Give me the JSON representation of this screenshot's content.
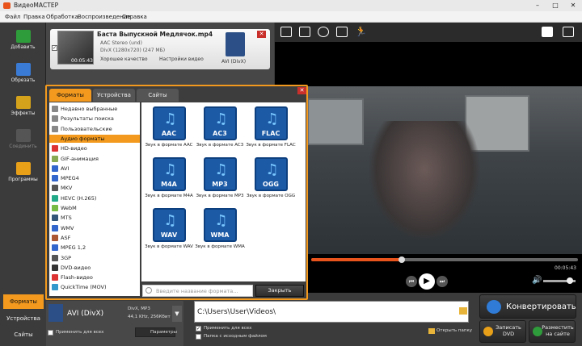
{
  "app": {
    "title": "ВидеоМАСТЕР"
  },
  "menu": [
    "Файл",
    "Правка",
    "Обработка",
    "Воспроизведение",
    "Справка"
  ],
  "sidebar": [
    {
      "label": "Добавить",
      "icon": "add-icon",
      "enabled": true
    },
    {
      "label": "Обрезать",
      "icon": "scissors-icon",
      "enabled": true
    },
    {
      "label": "Эффекты",
      "icon": "effects-icon",
      "enabled": true
    },
    {
      "label": "Соединить",
      "icon": "join-icon",
      "enabled": false
    },
    {
      "label": "Программы",
      "icon": "programs-icon",
      "enabled": true
    }
  ],
  "file": {
    "name": "Баста   Выпускной Медлячок.mp4",
    "audio": "AAC Stereo (und)",
    "video": "DivX (1280x720) (247 МБ)",
    "duration": "00:05:43",
    "quality": "Хорошее качество",
    "settings": "Настройки видео",
    "format": "AVI (DivX)"
  },
  "dialog": {
    "tabs": [
      "Форматы",
      "Устройства",
      "Сайты"
    ],
    "categories": [
      "Недавно выбранные",
      "Результаты поиска",
      "Пользовательские",
      "Аудио форматы",
      "HD-видео",
      "GIF-анимация",
      "AVI",
      "MPEG4",
      "MKV",
      "HEVC (H.265)",
      "WebM",
      "MTS",
      "WMV",
      "ASF",
      "MPEG 1,2",
      "3GP",
      "DVD-видео",
      "Flash-видео",
      "QuickTime (MOV)"
    ],
    "selected_index": 3,
    "formats": [
      {
        "label": "AAC",
        "caption": "Звук в формате AAC"
      },
      {
        "label": "AC3",
        "caption": "Звук в формате AC3"
      },
      {
        "label": "FLAC",
        "caption": "Звук в формате FLAC"
      },
      {
        "label": "M4A",
        "caption": "Звук в формате M4A"
      },
      {
        "label": "MP3",
        "caption": "Звук в формате MP3"
      },
      {
        "label": "OGG",
        "caption": "Звук в формате OGG"
      },
      {
        "label": "WAV",
        "caption": "Звук в формате WAV"
      },
      {
        "label": "WMA",
        "caption": "Звук в формате WMA"
      }
    ],
    "search_placeholder": "Введите название формата...",
    "close_label": "Закрыть"
  },
  "player": {
    "time_end": "00:05:43",
    "progress": 0.34
  },
  "bottom": {
    "tabs": [
      "Форматы",
      "Устройства",
      "Сайты"
    ],
    "format": "AVI (DivX)",
    "format_info1": "DivX, MP3",
    "format_info2": "44,1 KHz, 256Кбит",
    "apply_all": "Применить для всех",
    "params": "Параметры",
    "output_path": "C:\\Users\\User\\Videos\\",
    "apply_all2": "Применить для всех",
    "source_folder": "Папка с исходным файлом",
    "open_folder": "Открыть папку",
    "convert": "Конвертировать",
    "dvd": "Записать DVD",
    "upload": "Разместить на сайте"
  },
  "colors": {
    "accent": "#f39a1e",
    "orange": "#e8541c",
    "blue": "#1c5aa6"
  }
}
